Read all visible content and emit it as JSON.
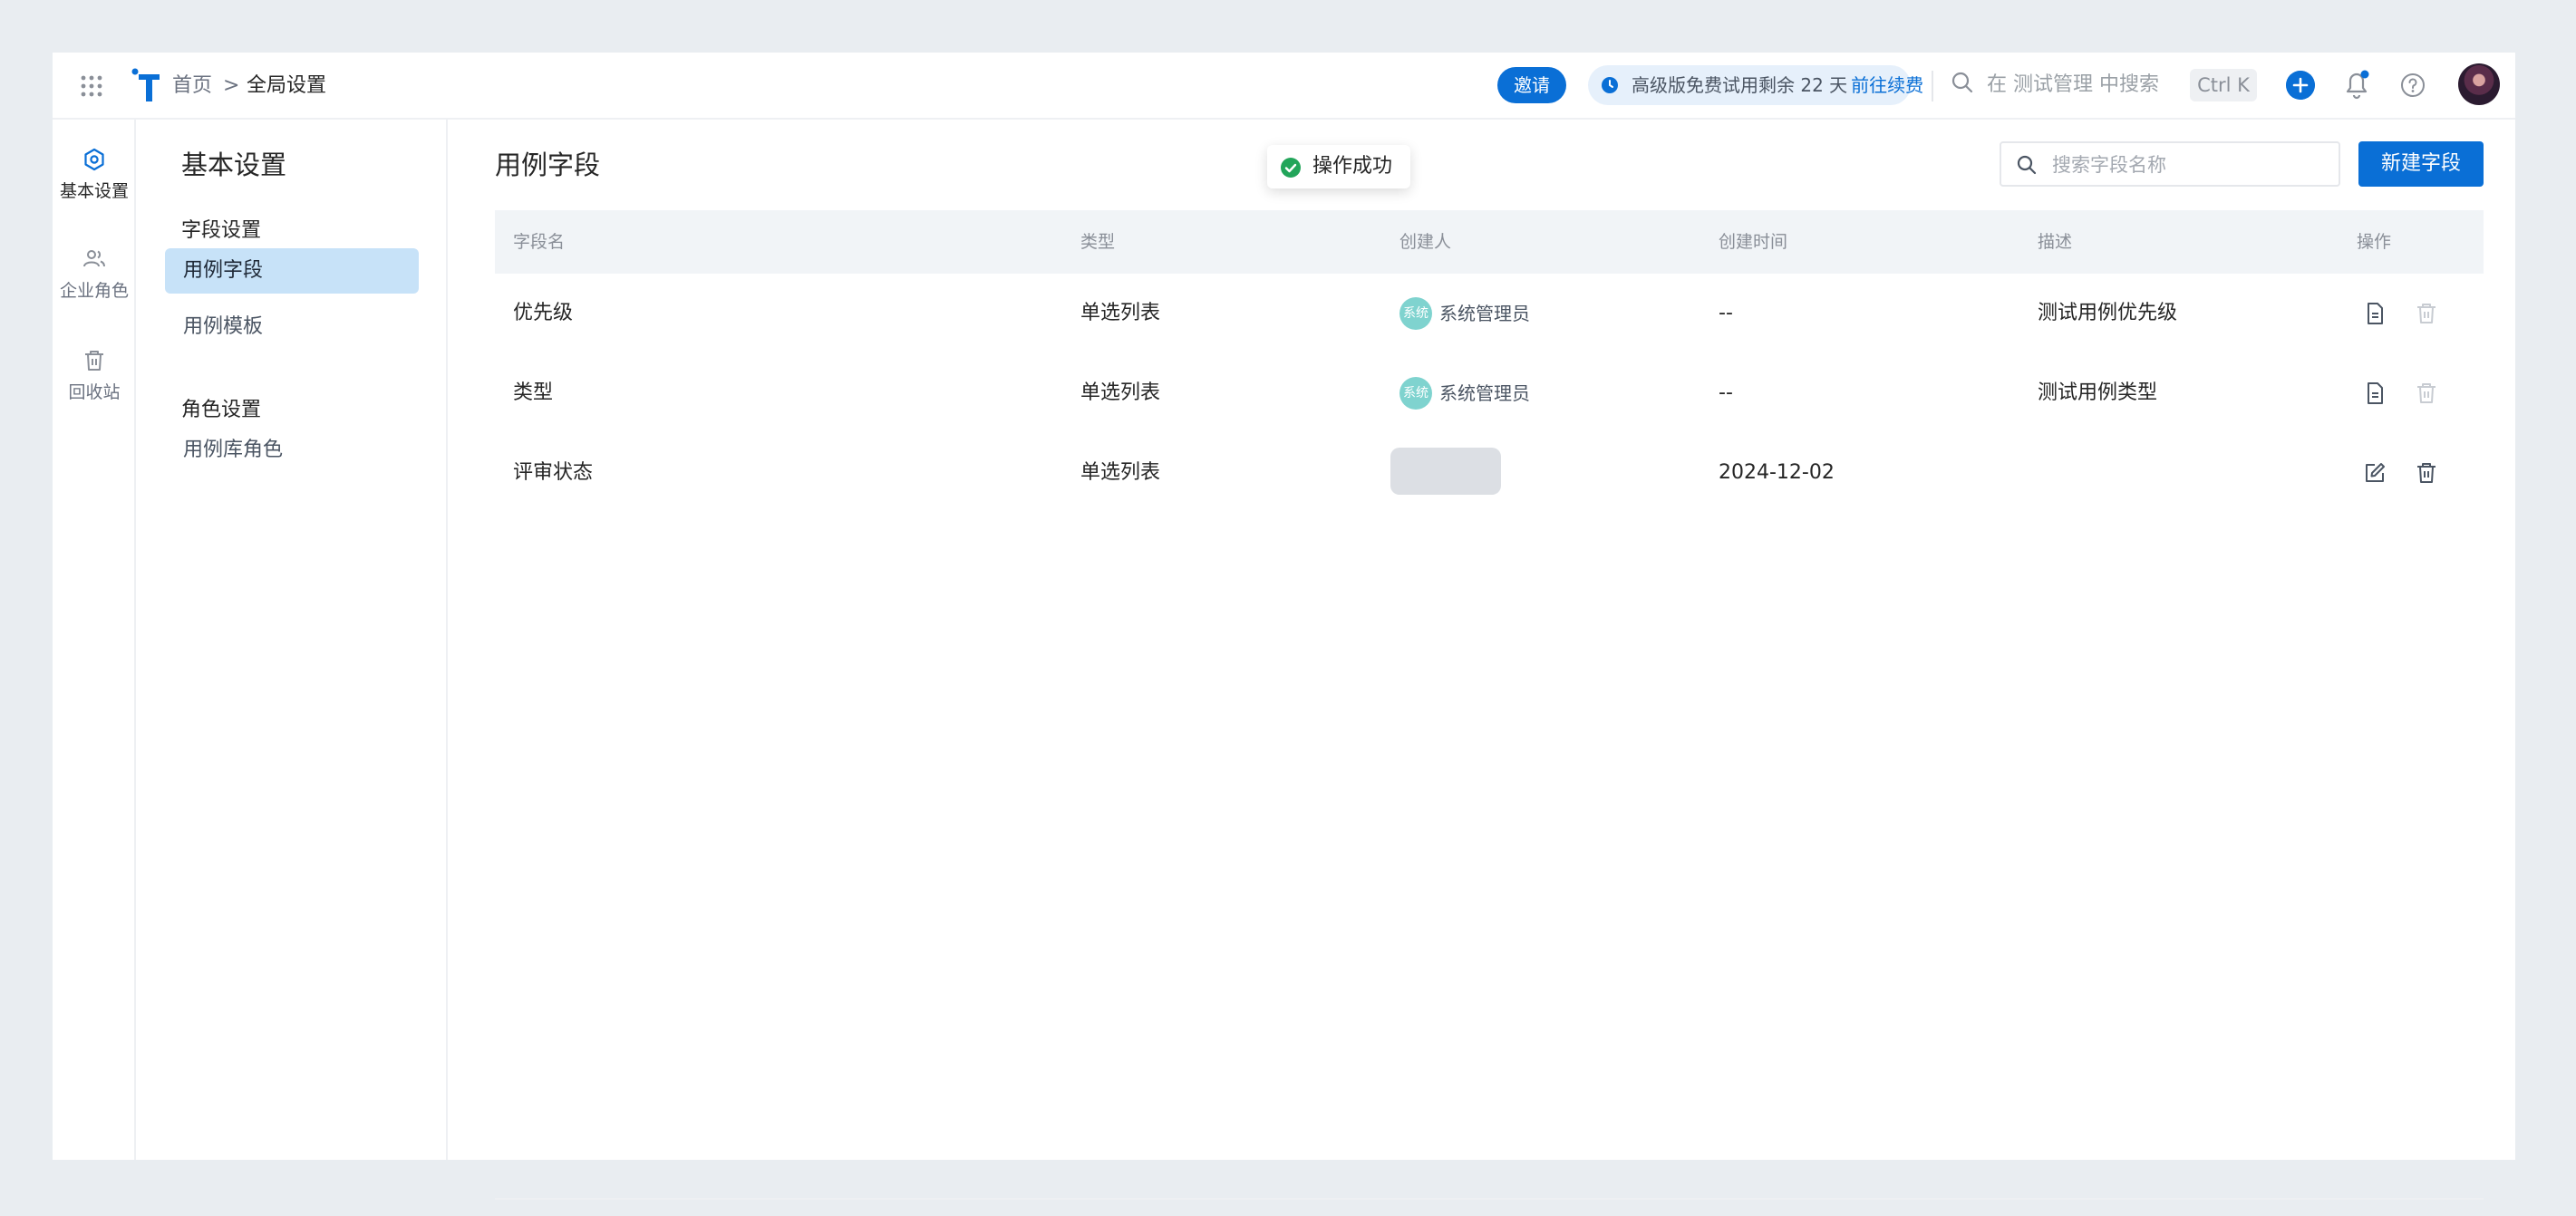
{
  "breadcrumb": {
    "home": "首页",
    "separator": ">",
    "current": "全局设置"
  },
  "header": {
    "invite_label": "邀请",
    "trial_text": "高级版免费试用剩余 22 天",
    "trial_link": "前往续费",
    "search_placeholder": "在 测试管理 中搜索",
    "shortcut": "Ctrl K"
  },
  "rail": {
    "items": [
      {
        "label": "基本设置",
        "icon": "settings-icon"
      },
      {
        "label": "企业角色",
        "icon": "users-icon"
      },
      {
        "label": "回收站",
        "icon": "trash-icon"
      }
    ]
  },
  "sidebar": {
    "title": "基本设置",
    "groups": [
      {
        "label": "字段设置",
        "items": [
          "用例字段",
          "用例模板"
        ]
      },
      {
        "label": "角色设置",
        "items": [
          "用例库角色"
        ]
      }
    ]
  },
  "main": {
    "title": "用例字段",
    "search_placeholder": "搜索字段名称",
    "new_button": "新建字段",
    "columns": [
      "字段名",
      "类型",
      "创建人",
      "创建时间",
      "描述",
      "操作"
    ],
    "rows": [
      {
        "name": "优先级",
        "type": "单选列表",
        "creator_badge": "系统",
        "creator": "系统管理员",
        "created": "--",
        "desc": "测试用例优先级"
      },
      {
        "name": "类型",
        "type": "单选列表",
        "creator_badge": "系统",
        "creator": "系统管理员",
        "created": "--",
        "desc": "测试用例类型"
      },
      {
        "name": "评审状态",
        "type": "单选列表",
        "creator_badge": "",
        "creator": "",
        "created": "2024-12-02",
        "desc": ""
      }
    ]
  },
  "toast": {
    "text": "操作成功"
  },
  "colors": {
    "primary": "#0a6fd6",
    "active_bg": "#c7e2f8",
    "success": "#22a55a"
  }
}
